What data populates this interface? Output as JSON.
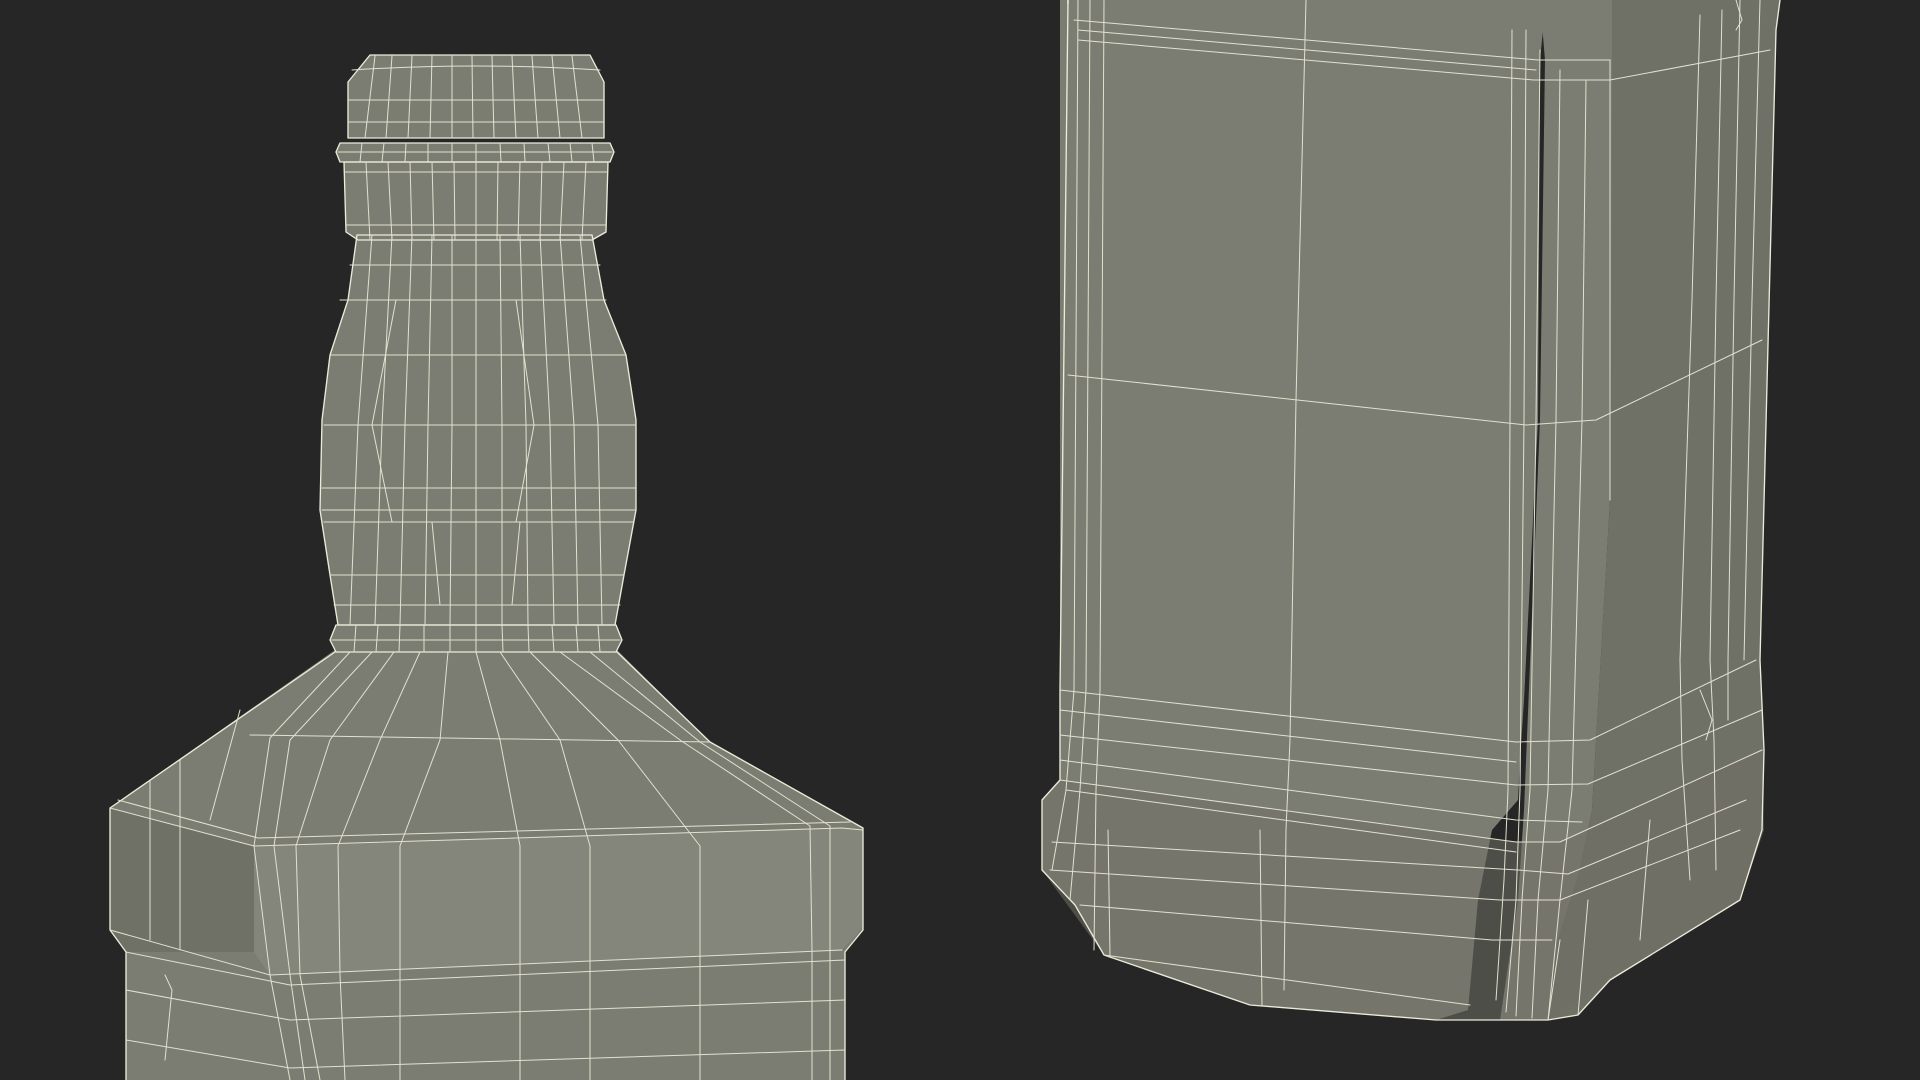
{
  "scene": {
    "background_color": "#262626",
    "mesh_fill_color": "#7c7d72",
    "wire_color": "#ecebd9",
    "views": [
      {
        "name": "bottle-neck-and-shoulder",
        "shading": "wireframe-on-shaded"
      },
      {
        "name": "bottle-body-and-base",
        "shading": "wireframe-on-shaded"
      }
    ]
  }
}
